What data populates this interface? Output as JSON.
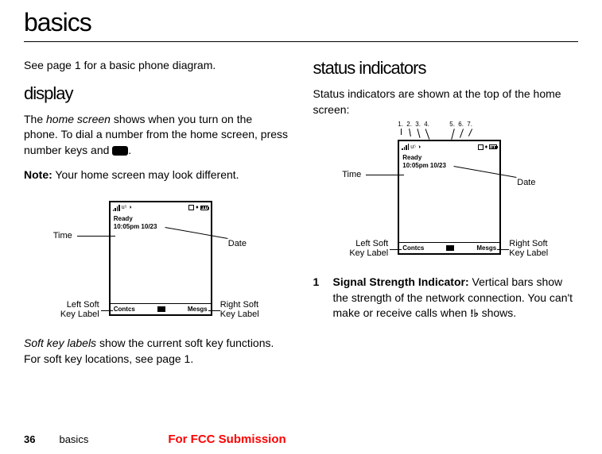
{
  "title": "basics",
  "left_column": {
    "intro": "See page 1 for a basic phone diagram.",
    "heading": "display",
    "para1_a": "The ",
    "para1_italic": "home screen",
    "para1_b": " shows when you turn on the phone. To dial a number from the home screen, press number keys and ",
    "para1_c": ".",
    "note_bold": "Note:",
    "note_text": " Your home screen may look different.",
    "closing_italic": "Soft key labels",
    "closing_text": " show the current soft key functions. For soft key locations, see page 1."
  },
  "right_column": {
    "heading": "status indicators",
    "para1": "Status indicators are shown at the top of the home screen:",
    "list1_num": "1",
    "list1_bold": "Signal Strength Indicator:",
    "list1_text": " Vertical bars show the strength of the network connection. You can't make or receive calls when ",
    "list1_text2": " shows."
  },
  "diagram": {
    "ready": "Ready",
    "time_date": "10:05pm 10/23",
    "contcs": "Contcs",
    "mesgs": "Mesgs",
    "time_label": "Time",
    "date_label": "Date",
    "left_soft_label": "Left Soft\nKey Label",
    "right_soft_label": "Right Soft\nKey Label"
  },
  "indicators": {
    "n1": "1.",
    "n2": "2.",
    "n3": "3.",
    "n4": "4.",
    "n5": "5.",
    "n6": "6.",
    "n7": "7."
  },
  "footer": {
    "page_num": "36",
    "section": "basics",
    "fcc": "For FCC Submission"
  }
}
